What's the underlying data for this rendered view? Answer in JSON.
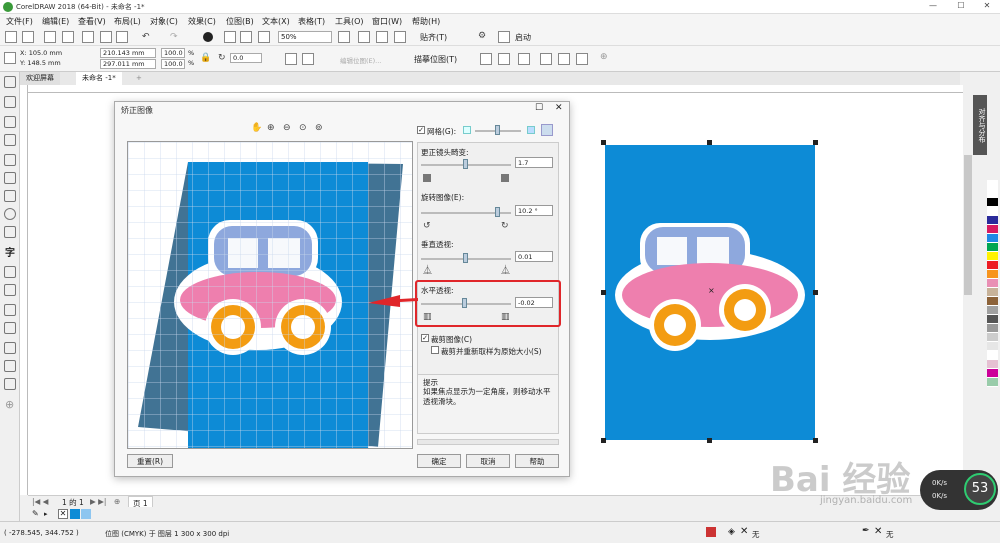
{
  "app": {
    "title": "CorelDRAW 2018 (64-Bit) - 未命名 -1*"
  },
  "menu": [
    "文件(F)",
    "编辑(E)",
    "查看(V)",
    "布局(L)",
    "对象(C)",
    "效果(C)",
    "位图(B)",
    "文本(X)",
    "表格(T)",
    "工具(O)",
    "窗口(W)",
    "帮助(H)"
  ],
  "toolbar": {
    "zoom": "50%",
    "snap": "贴齐(T)",
    "launch": "启动"
  },
  "props": {
    "x": "X: 105.0 mm",
    "y": "Y: 148.5 mm",
    "w": "210.143 mm",
    "h": "297.011 mm",
    "sx": "100.0",
    "sy": "100.0",
    "sx_unit": "%",
    "sy_unit": "%",
    "angle": "0.0",
    "trace": "描摹位图(T)",
    "edit": "编辑位图(E)..."
  },
  "tabs": {
    "welcome": "欢迎屏幕",
    "doc": "未命名 -1*"
  },
  "docker_tab": "对齐与分布",
  "dialog": {
    "title": "矫正图像",
    "grid_label": "网格(G):",
    "lens_label": "更正镜头畸变:",
    "lens_value": "1.7",
    "rotate_label": "旋转图像(E):",
    "rotate_value": "10.2 °",
    "vertical_label": "垂直透视:",
    "vertical_value": "0.01",
    "horizontal_label": "水平透视:",
    "horizontal_value": "-0.02",
    "crop_label": "裁剪图像(C)",
    "crop_resample_label": "裁剪并重新取样为原始大小(S)",
    "tip_title": "提示",
    "tip_text": "如果焦点显示为一定角度，则移动水平透视滑块。",
    "reset": "重置(R)",
    "ok": "确定",
    "cancel": "取消",
    "help": "帮助"
  },
  "docbar": {
    "page_of": "1 的 1",
    "page_tab": "页 1"
  },
  "status": {
    "coords": "( -278.545, 344.752 )",
    "info": "位图 (CMYK) 于 图层 1 300 x 300 dpi",
    "fill_none": "无",
    "outline_none": "无"
  },
  "watermark": {
    "logo": "Bai 经验",
    "url": "jingyan.baidu.com"
  },
  "speed": {
    "percent": "53",
    "up": "0K/s",
    "down": "0K/s"
  },
  "colors": {
    "accent": "#0d8bd6",
    "red_box": "#e0262a",
    "car_body": "#ee7fae",
    "wheel": "#f39c12",
    "window": "#8ea8dd"
  },
  "palette": [
    "#ffffff",
    "#ffffff",
    "#000000",
    "#ffffff",
    "#2a2a9a",
    "#d81b60",
    "#1e88e5",
    "#00a651",
    "#fff200",
    "#ed1c24",
    "#f7941d",
    "#e98fb4",
    "#c7b299",
    "#8c6239",
    "#a0a0a0",
    "#555555",
    "#999999",
    "#cccccc",
    "#e6e6e6",
    "#ffffff",
    "#e5c0d2",
    "#c09",
    "#9ca"
  ]
}
